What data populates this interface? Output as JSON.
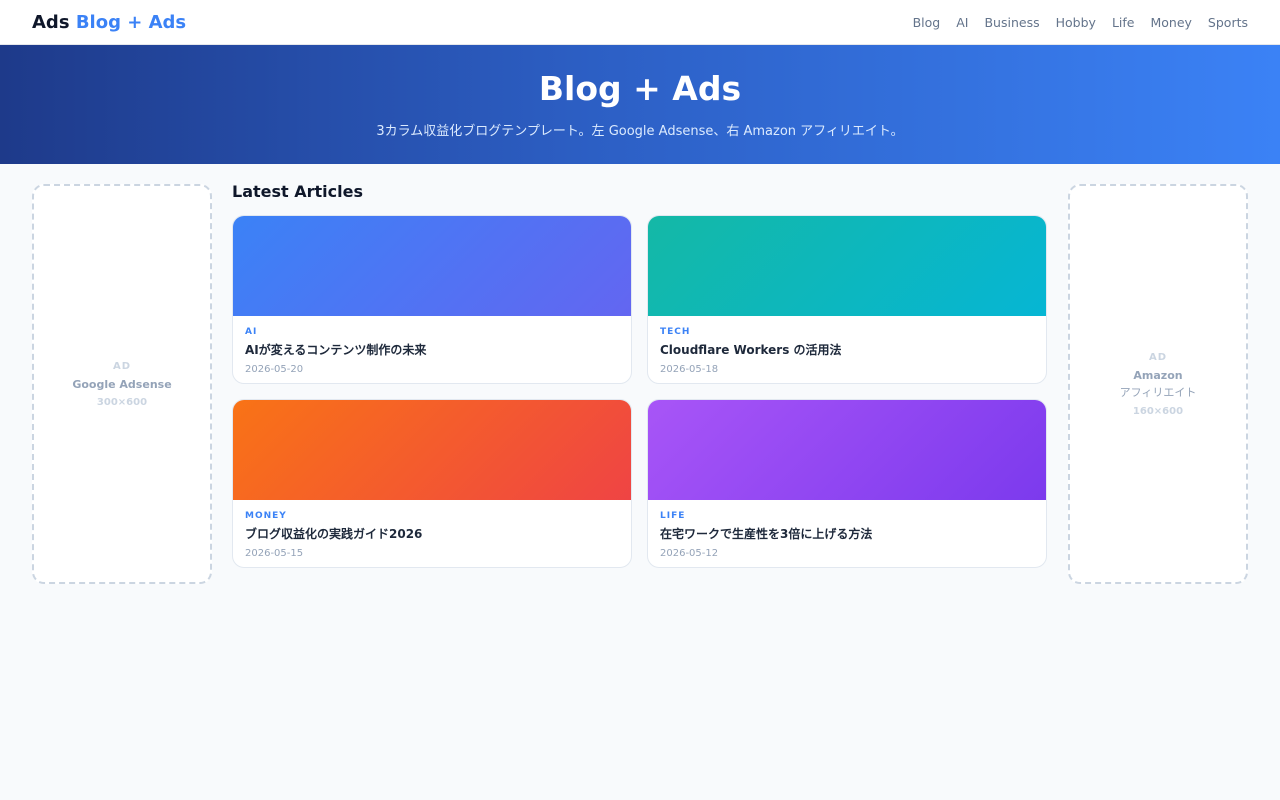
{
  "header": {
    "logo_part1": "Ads",
    "logo_part2": "Blog + Ads",
    "nav": [
      "Blog",
      "AI",
      "Business",
      "Hobby",
      "Life",
      "Money",
      "Sports"
    ]
  },
  "hero": {
    "title": "Blog + Ads",
    "subtitle": "3カラム収益化ブログテンプレート。左 Google Adsense、右 Amazon アフィリエイト。"
  },
  "ads": {
    "left": {
      "tag": "AD",
      "name": "Google Adsense",
      "size": "300×600"
    },
    "right": {
      "tag": "AD",
      "name": "Amazon",
      "name2": "アフィリエイト",
      "size": "160×600"
    }
  },
  "main": {
    "heading": "Latest Articles",
    "articles": [
      {
        "category": "AI",
        "title": "AIが変えるコンテンツ制作の未来",
        "date": "2026-05-20",
        "gradient": [
          "#3b82f6",
          "#6366f1"
        ]
      },
      {
        "category": "TECH",
        "title": "Cloudflare Workers の活用法",
        "date": "2026-05-18",
        "gradient": [
          "#14b8a6",
          "#06b6d4"
        ]
      },
      {
        "category": "MONEY",
        "title": "ブログ収益化の実践ガイド2026",
        "date": "2026-05-15",
        "gradient": [
          "#f97316",
          "#ef4444"
        ]
      },
      {
        "category": "LIFE",
        "title": "在宅ワークで生産性を3倍に上げる方法",
        "date": "2026-05-12",
        "gradient": [
          "#a855f7",
          "#7c3aed"
        ]
      }
    ]
  }
}
